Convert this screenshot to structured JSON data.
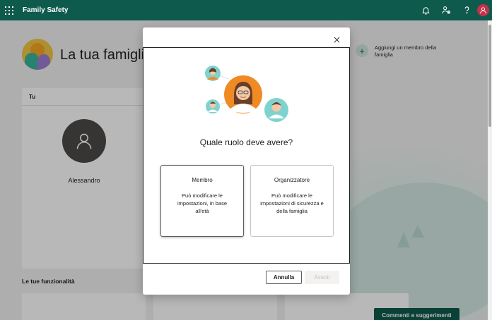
{
  "topbar": {
    "app_title": "Family Safety",
    "icons": [
      "waffle-icon",
      "bell-icon",
      "people-settings-icon",
      "help-icon",
      "user-avatar-icon"
    ]
  },
  "page": {
    "family_title": "La tua famiglia",
    "add_member_label": "Aggiungi un membro della famiglia",
    "member_card": {
      "header": "Tu",
      "name": "Alessandro"
    },
    "features_title": "Le tue funzionalità",
    "feedback_button": "Commenti e suggerimenti"
  },
  "dialog": {
    "title": "Quale ruolo deve avere?",
    "roles": [
      {
        "name": "Membro",
        "description": "Può modificare le impostazioni, in base all'età",
        "selected": true
      },
      {
        "name": "Organizzatore",
        "description": "Può modificare le impostazioni di sicurezza e della famiglia",
        "selected": false
      }
    ],
    "cancel_label": "Annulla",
    "next_label": "Avanti",
    "next_enabled": false
  },
  "colors": {
    "brand": "#0e5a4c",
    "accent_orange": "#f08a24",
    "accent_teal": "#7fd3cf"
  }
}
